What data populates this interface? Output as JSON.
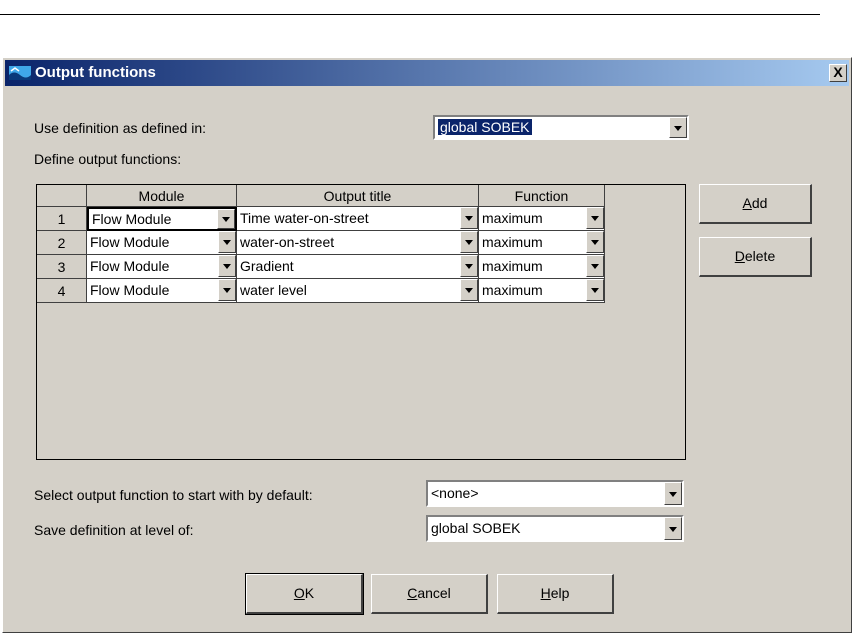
{
  "window": {
    "title": "Output functions",
    "close_label": "X"
  },
  "use_definition": {
    "label": "Use definition as defined in:",
    "value": "global SOBEK"
  },
  "define_label": "Define output functions:",
  "grid": {
    "headers": [
      "Module",
      "Output title",
      "Function"
    ],
    "rows": [
      {
        "num": "1",
        "module": "Flow Module",
        "title": "Time water-on-street",
        "func": "maximum"
      },
      {
        "num": "2",
        "module": "Flow Module",
        "title": "water-on-street",
        "func": "maximum"
      },
      {
        "num": "3",
        "module": "Flow Module",
        "title": "Gradient",
        "func": "maximum"
      },
      {
        "num": "4",
        "module": "Flow Module",
        "title": "water level",
        "func": "maximum"
      }
    ]
  },
  "buttons": {
    "add": {
      "pre": "",
      "key": "A",
      "post": "dd"
    },
    "delete": {
      "pre": "",
      "key": "D",
      "post": "elete"
    },
    "ok": {
      "pre": "",
      "key": "O",
      "post": "K"
    },
    "cancel": {
      "pre": "",
      "key": "C",
      "post": "ancel"
    },
    "help": {
      "pre": "",
      "key": "H",
      "post": "elp"
    }
  },
  "default_select": {
    "label": "Select output function to start with by default:",
    "value": "<none>"
  },
  "save_level": {
    "label": "Save definition at level of:",
    "value": "global SOBEK"
  },
  "colors": {
    "title_start": "#0a246a",
    "title_end": "#a6caf0",
    "face": "#d4d0c8"
  },
  "icons": {
    "window": "sobek-app-icon",
    "close": "close-icon",
    "dropdown": "chevron-down-icon"
  }
}
